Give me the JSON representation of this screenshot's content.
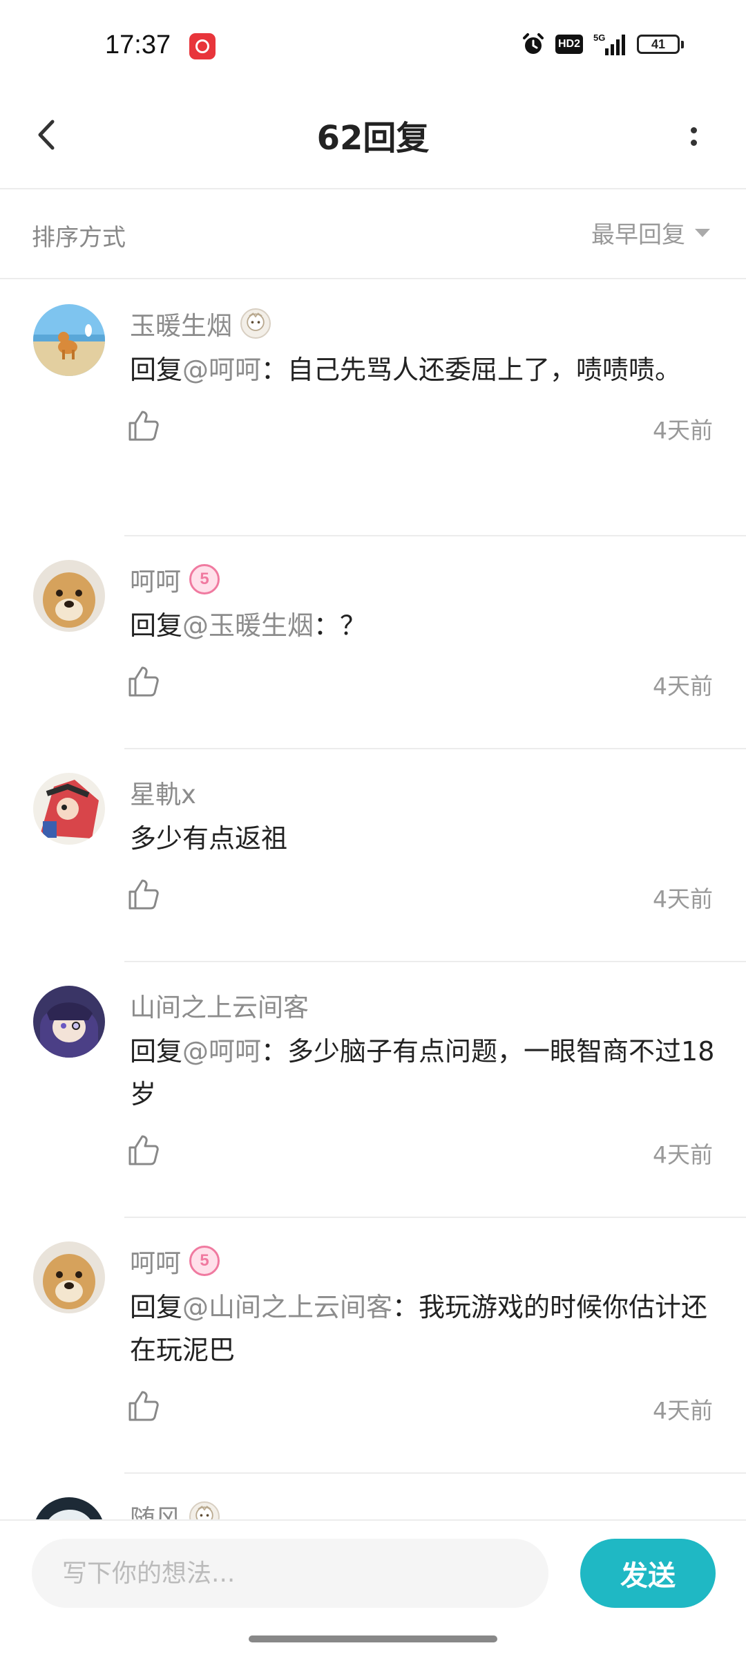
{
  "status_bar": {
    "time": "17:37",
    "network": "5G",
    "hd_label": "HD2",
    "battery": "41"
  },
  "header": {
    "title": "62回复"
  },
  "sort": {
    "label": "排序方式",
    "value": "最早回复"
  },
  "comments": [
    {
      "username": "玉暖生烟",
      "badge": "chibi-badge-icon",
      "prefix": "回复",
      "mention": "@呵呵",
      "text": "：自己先骂人还委屈上了，啧啧啧。",
      "time": "4天前"
    },
    {
      "username": "呵呵",
      "badge_level": "5",
      "prefix": "回复",
      "mention": "@玉暖生烟",
      "text": "：？",
      "time": "4天前"
    },
    {
      "username": "星軌x",
      "text": "多少有点返祖",
      "time": "4天前"
    },
    {
      "username": "山间之上云间客",
      "prefix": "回复",
      "mention": "@呵呵",
      "text": "：多少脑子有点问题，一眼智商不过18岁",
      "time": "4天前"
    },
    {
      "username": "呵呵",
      "badge_level": "5",
      "prefix": "回复",
      "mention": "@山间之上云间客",
      "text": "：我玩游戏的时候你估计还在玩泥巴",
      "time": "4天前"
    },
    {
      "username": "随风",
      "badge": "chibi-badge-icon"
    }
  ],
  "input": {
    "placeholder": "写下你的想法...",
    "send_label": "发送"
  },
  "colors": {
    "accent": "#1fb8c4",
    "secondary_text": "#8c8c8c",
    "level_badge": "#f07aa0"
  }
}
